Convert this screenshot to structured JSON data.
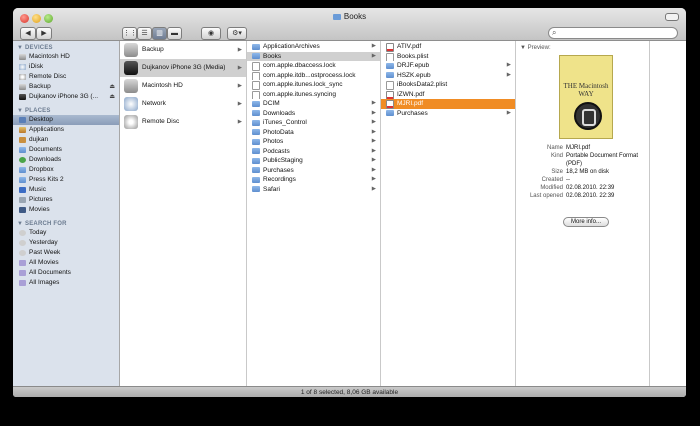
{
  "window": {
    "title": "Books"
  },
  "toolbar": {
    "back": "◀",
    "forward": "▶",
    "view_icons": "⋮⋮",
    "view_list": "☰",
    "view_columns": "▥",
    "view_coverflow": "▬",
    "quicklook": "◉",
    "action": "⚙▾"
  },
  "sidebar": {
    "devices_header": "▼ DEVICES",
    "devices": [
      {
        "label": "Macintosh HD"
      },
      {
        "label": "iDisk"
      },
      {
        "label": "Remote Disc"
      },
      {
        "label": "Backup",
        "eject": "⏏"
      },
      {
        "label": "Dujkanov iPhone 3G (...",
        "eject": "⏏"
      }
    ],
    "places_header": "▼ PLACES",
    "places": [
      {
        "label": "Desktop"
      },
      {
        "label": "Applications"
      },
      {
        "label": "dujkan"
      },
      {
        "label": "Documents"
      },
      {
        "label": "Downloads"
      },
      {
        "label": "Dropbox"
      },
      {
        "label": "Press Kits 2"
      },
      {
        "label": "Music"
      },
      {
        "label": "Pictures"
      },
      {
        "label": "Movies"
      }
    ],
    "search_header": "▼ SEARCH FOR",
    "search": [
      {
        "label": "Today"
      },
      {
        "label": "Yesterday"
      },
      {
        "label": "Past Week"
      },
      {
        "label": "All Movies"
      },
      {
        "label": "All Documents"
      },
      {
        "label": "All Images"
      }
    ]
  },
  "col1": [
    {
      "label": "Backup"
    },
    {
      "label": "Dujkanov iPhone 3G (Media)"
    },
    {
      "label": "Macintosh HD"
    },
    {
      "label": "Network"
    },
    {
      "label": "Remote Disc"
    }
  ],
  "col2": [
    {
      "label": "ApplicationArchives"
    },
    {
      "label": "Books"
    },
    {
      "label": "com.apple.dbaccess.lock"
    },
    {
      "label": "com.apple.itdb...ostprocess.lock"
    },
    {
      "label": "com.apple.itunes.lock_sync"
    },
    {
      "label": "com.apple.itunes.syncing"
    },
    {
      "label": "DCIM"
    },
    {
      "label": "Downloads"
    },
    {
      "label": "iTunes_Control"
    },
    {
      "label": "PhotoData"
    },
    {
      "label": "Photos"
    },
    {
      "label": "Podcasts"
    },
    {
      "label": "PublicStaging"
    },
    {
      "label": "Purchases"
    },
    {
      "label": "Recordings"
    },
    {
      "label": "Safari"
    }
  ],
  "col3": [
    {
      "label": "ATIV.pdf"
    },
    {
      "label": "Books.plist"
    },
    {
      "label": "DRJF.epub"
    },
    {
      "label": "HSZK.epub"
    },
    {
      "label": "iBooksData2.plist"
    },
    {
      "label": "IZWN.pdf"
    },
    {
      "label": "MJRI.pdf"
    },
    {
      "label": "Purchases"
    }
  ],
  "preview": {
    "label": "▼ Preview:",
    "cover_title": "THE Macintosh WAY",
    "info": [
      {
        "k": "Name",
        "v": "MJRI.pdf"
      },
      {
        "k": "Kind",
        "v": "Portable Document Format (PDF)"
      },
      {
        "k": "Size",
        "v": "18,2 MB on disk"
      },
      {
        "k": "Created",
        "v": "--"
      },
      {
        "k": "Modified",
        "v": "02.08.2010. 22:39"
      },
      {
        "k": "Last opened",
        "v": "02.08.2010. 22:39"
      }
    ],
    "more_info": "More info..."
  },
  "status": "1 of 8 selected, 8,06 GB available",
  "colors": {
    "selection": "#f08c24",
    "sidebar_bg": "#dbe2ec"
  }
}
